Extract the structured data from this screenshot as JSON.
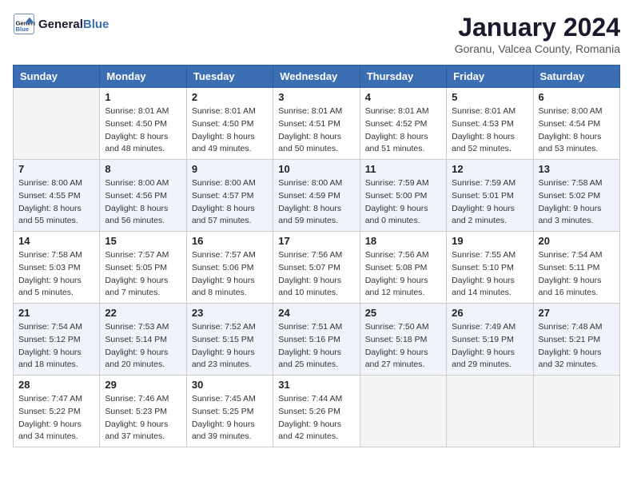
{
  "header": {
    "logo_general": "General",
    "logo_blue": "Blue",
    "month": "January 2024",
    "location": "Goranu, Valcea County, Romania"
  },
  "days_of_week": [
    "Sunday",
    "Monday",
    "Tuesday",
    "Wednesday",
    "Thursday",
    "Friday",
    "Saturday"
  ],
  "weeks": [
    [
      {
        "num": "",
        "info": ""
      },
      {
        "num": "1",
        "info": "Sunrise: 8:01 AM\nSunset: 4:50 PM\nDaylight: 8 hours\nand 48 minutes."
      },
      {
        "num": "2",
        "info": "Sunrise: 8:01 AM\nSunset: 4:50 PM\nDaylight: 8 hours\nand 49 minutes."
      },
      {
        "num": "3",
        "info": "Sunrise: 8:01 AM\nSunset: 4:51 PM\nDaylight: 8 hours\nand 50 minutes."
      },
      {
        "num": "4",
        "info": "Sunrise: 8:01 AM\nSunset: 4:52 PM\nDaylight: 8 hours\nand 51 minutes."
      },
      {
        "num": "5",
        "info": "Sunrise: 8:01 AM\nSunset: 4:53 PM\nDaylight: 8 hours\nand 52 minutes."
      },
      {
        "num": "6",
        "info": "Sunrise: 8:00 AM\nSunset: 4:54 PM\nDaylight: 8 hours\nand 53 minutes."
      }
    ],
    [
      {
        "num": "7",
        "info": "Sunrise: 8:00 AM\nSunset: 4:55 PM\nDaylight: 8 hours\nand 55 minutes."
      },
      {
        "num": "8",
        "info": "Sunrise: 8:00 AM\nSunset: 4:56 PM\nDaylight: 8 hours\nand 56 minutes."
      },
      {
        "num": "9",
        "info": "Sunrise: 8:00 AM\nSunset: 4:57 PM\nDaylight: 8 hours\nand 57 minutes."
      },
      {
        "num": "10",
        "info": "Sunrise: 8:00 AM\nSunset: 4:59 PM\nDaylight: 8 hours\nand 59 minutes."
      },
      {
        "num": "11",
        "info": "Sunrise: 7:59 AM\nSunset: 5:00 PM\nDaylight: 9 hours\nand 0 minutes."
      },
      {
        "num": "12",
        "info": "Sunrise: 7:59 AM\nSunset: 5:01 PM\nDaylight: 9 hours\nand 2 minutes."
      },
      {
        "num": "13",
        "info": "Sunrise: 7:58 AM\nSunset: 5:02 PM\nDaylight: 9 hours\nand 3 minutes."
      }
    ],
    [
      {
        "num": "14",
        "info": "Sunrise: 7:58 AM\nSunset: 5:03 PM\nDaylight: 9 hours\nand 5 minutes."
      },
      {
        "num": "15",
        "info": "Sunrise: 7:57 AM\nSunset: 5:05 PM\nDaylight: 9 hours\nand 7 minutes."
      },
      {
        "num": "16",
        "info": "Sunrise: 7:57 AM\nSunset: 5:06 PM\nDaylight: 9 hours\nand 8 minutes."
      },
      {
        "num": "17",
        "info": "Sunrise: 7:56 AM\nSunset: 5:07 PM\nDaylight: 9 hours\nand 10 minutes."
      },
      {
        "num": "18",
        "info": "Sunrise: 7:56 AM\nSunset: 5:08 PM\nDaylight: 9 hours\nand 12 minutes."
      },
      {
        "num": "19",
        "info": "Sunrise: 7:55 AM\nSunset: 5:10 PM\nDaylight: 9 hours\nand 14 minutes."
      },
      {
        "num": "20",
        "info": "Sunrise: 7:54 AM\nSunset: 5:11 PM\nDaylight: 9 hours\nand 16 minutes."
      }
    ],
    [
      {
        "num": "21",
        "info": "Sunrise: 7:54 AM\nSunset: 5:12 PM\nDaylight: 9 hours\nand 18 minutes."
      },
      {
        "num": "22",
        "info": "Sunrise: 7:53 AM\nSunset: 5:14 PM\nDaylight: 9 hours\nand 20 minutes."
      },
      {
        "num": "23",
        "info": "Sunrise: 7:52 AM\nSunset: 5:15 PM\nDaylight: 9 hours\nand 23 minutes."
      },
      {
        "num": "24",
        "info": "Sunrise: 7:51 AM\nSunset: 5:16 PM\nDaylight: 9 hours\nand 25 minutes."
      },
      {
        "num": "25",
        "info": "Sunrise: 7:50 AM\nSunset: 5:18 PM\nDaylight: 9 hours\nand 27 minutes."
      },
      {
        "num": "26",
        "info": "Sunrise: 7:49 AM\nSunset: 5:19 PM\nDaylight: 9 hours\nand 29 minutes."
      },
      {
        "num": "27",
        "info": "Sunrise: 7:48 AM\nSunset: 5:21 PM\nDaylight: 9 hours\nand 32 minutes."
      }
    ],
    [
      {
        "num": "28",
        "info": "Sunrise: 7:47 AM\nSunset: 5:22 PM\nDaylight: 9 hours\nand 34 minutes."
      },
      {
        "num": "29",
        "info": "Sunrise: 7:46 AM\nSunset: 5:23 PM\nDaylight: 9 hours\nand 37 minutes."
      },
      {
        "num": "30",
        "info": "Sunrise: 7:45 AM\nSunset: 5:25 PM\nDaylight: 9 hours\nand 39 minutes."
      },
      {
        "num": "31",
        "info": "Sunrise: 7:44 AM\nSunset: 5:26 PM\nDaylight: 9 hours\nand 42 minutes."
      },
      {
        "num": "",
        "info": ""
      },
      {
        "num": "",
        "info": ""
      },
      {
        "num": "",
        "info": ""
      }
    ]
  ]
}
